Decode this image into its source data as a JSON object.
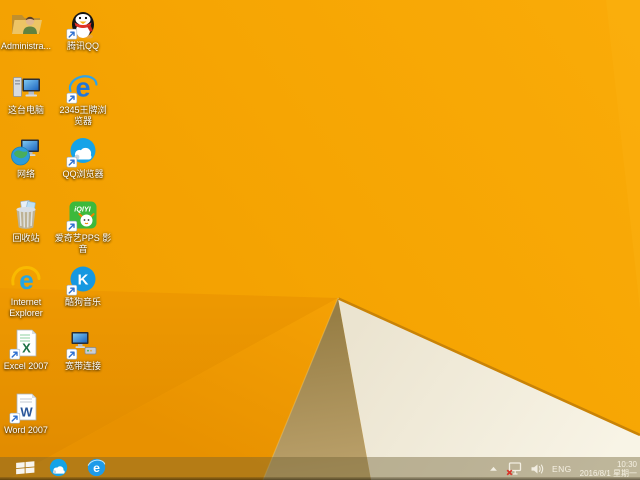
{
  "wallpaper": {
    "base_orange": "#F2A000",
    "bright_orange": "#FAAB08",
    "left_facet_orange": "#EE9901",
    "dark_facet_orange": "#E08A00",
    "shadow_tan": "#AC9155",
    "cream_white": "#F5F0DF",
    "fold_line_color": "#C98307"
  },
  "desktop": {
    "icons": [
      {
        "id": "admin-folder",
        "label": "Administra...",
        "col": 0,
        "row": 0
      },
      {
        "id": "qq",
        "label": "腾讯QQ",
        "col": 1,
        "row": 0
      },
      {
        "id": "this-pc",
        "label": "这台电脑",
        "col": 0,
        "row": 1
      },
      {
        "id": "browser-2345",
        "label": "2345王牌浏\n览器",
        "col": 1,
        "row": 1
      },
      {
        "id": "network",
        "label": "网络",
        "col": 0,
        "row": 2
      },
      {
        "id": "qq-browser",
        "label": "QQ浏览器",
        "col": 1,
        "row": 2
      },
      {
        "id": "recycle-bin",
        "label": "回收站",
        "col": 0,
        "row": 3
      },
      {
        "id": "iqiyi-pps",
        "label": "爱奇艺PPS 影\n音",
        "col": 1,
        "row": 3
      },
      {
        "id": "internet-explorer",
        "label": "Internet\nExplorer",
        "col": 0,
        "row": 4
      },
      {
        "id": "kugou-music",
        "label": "酷狗音乐",
        "col": 1,
        "row": 4
      },
      {
        "id": "excel-2007",
        "label": "Excel 2007",
        "col": 0,
        "row": 5
      },
      {
        "id": "broadband",
        "label": "宽带连接",
        "col": 1,
        "row": 5
      },
      {
        "id": "word-2007",
        "label": "Word 2007",
        "col": 0,
        "row": 6
      }
    ]
  },
  "taskbar": {
    "buttons": [
      "start",
      "qq-browser",
      "internet-explorer"
    ],
    "tray": {
      "icons": [
        "show-hidden-icons",
        "network-disconnected",
        "volume"
      ],
      "language": "ENG",
      "time": "10:30",
      "date": "2016/8/1 星期一"
    }
  }
}
